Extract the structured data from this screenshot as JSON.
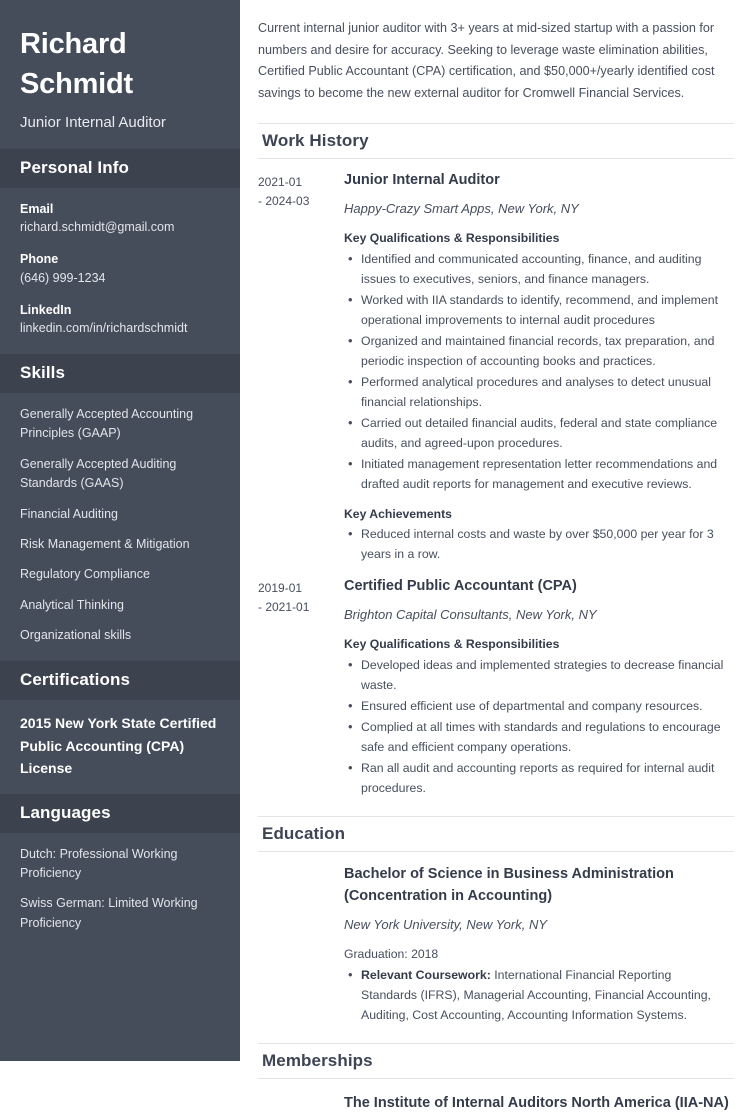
{
  "theme": {
    "sidebar_bg": "#454c5a",
    "sidebar_header_bg": "#3c434f",
    "text_dark": "#3d4454",
    "rule": "#e2e4e8"
  },
  "sidebar": {
    "name": "Richard Schmidt",
    "job_title": "Junior Internal Auditor",
    "personal_info": {
      "heading": "Personal Info",
      "items": [
        {
          "label": "Email",
          "value": "richard.schmidt@gmail.com"
        },
        {
          "label": "Phone",
          "value": "(646) 999-1234"
        },
        {
          "label": "LinkedIn",
          "value": "linkedin.com/in/richardschmidt"
        }
      ]
    },
    "skills": {
      "heading": "Skills",
      "items": [
        "Generally Accepted Accounting Principles (GAAP)",
        "Generally Accepted Auditing Standards (GAAS)",
        "Financial Auditing",
        "Risk Management & Mitigation",
        "Regulatory Compliance",
        "Analytical Thinking",
        "Organizational skills"
      ]
    },
    "certifications": {
      "heading": "Certifications",
      "items": [
        "2015 New York State Certified Public Accounting (CPA) License"
      ]
    },
    "languages": {
      "heading": "Languages",
      "items": [
        "Dutch: Professional Working Proficiency",
        "Swiss German: Limited Working Proficiency"
      ]
    }
  },
  "main": {
    "summary": "Current internal junior auditor with 3+ years at mid-sized startup with a passion for numbers and desire for accuracy. Seeking to leverage waste elimination abilities, Certified Public Accountant (CPA) certification, and $50,000+/yearly identified cost savings to become the new external auditor for Cromwell Financial Services.",
    "work_history": {
      "heading": "Work History",
      "entries": [
        {
          "date_start": "2021-01",
          "date_end": "- 2024-03",
          "role": "Junior Internal Auditor",
          "organization": "Happy-Crazy Smart Apps, New York, NY",
          "qualifications_label": "Key Qualifications & Responsibilities",
          "qualifications": [
            "Identified and communicated accounting, finance, and auditing issues to executives, seniors, and finance managers.",
            "Worked with IIA standards to identify, recommend, and implement operational improvements to internal audit procedures",
            "Organized and maintained financial records, tax preparation, and periodic inspection of accounting books and practices.",
            "Performed analytical procedures and analyses to detect unusual financial relationships.",
            "Carried out detailed financial audits, federal and state compliance audits, and agreed-upon procedures.",
            "Initiated management representation letter recommendations and drafted audit reports for management and executive reviews."
          ],
          "achievements_label": "Key Achievements",
          "achievements": [
            "Reduced internal costs and waste by over $50,000 per year for 3 years in a row."
          ]
        },
        {
          "date_start": "2019-01",
          "date_end": "- 2021-01",
          "role": "Certified Public Accountant (CPA)",
          "organization": "Brighton Capital Consultants, New York, NY",
          "qualifications_label": "Key Qualifications & Responsibilities",
          "qualifications": [
            "Developed ideas and implemented strategies to decrease financial waste.",
            "Ensured efficient use of departmental and company resources.",
            "Complied at all times with standards and regulations to encourage safe and efficient company operations.",
            "Ran all audit and accounting reports as required for internal audit procedures."
          ],
          "achievements_label": "",
          "achievements": []
        }
      ]
    },
    "education": {
      "heading": "Education",
      "entries": [
        {
          "degree": "Bachelor of Science in Business Administration (Concentration in Accounting)",
          "school": "New York University, New York, NY",
          "graduation": "Graduation: 2018",
          "coursework_label": "Relevant Coursework:",
          "coursework": " International Financial Reporting Standards (IFRS), Managerial Accounting, Financial Accounting, Auditing, Cost Accounting, Accounting Information Systems."
        }
      ]
    },
    "memberships": {
      "heading": "Memberships",
      "entries": [
        "The Institute of Internal Auditors North America (IIA-NA)"
      ]
    }
  }
}
